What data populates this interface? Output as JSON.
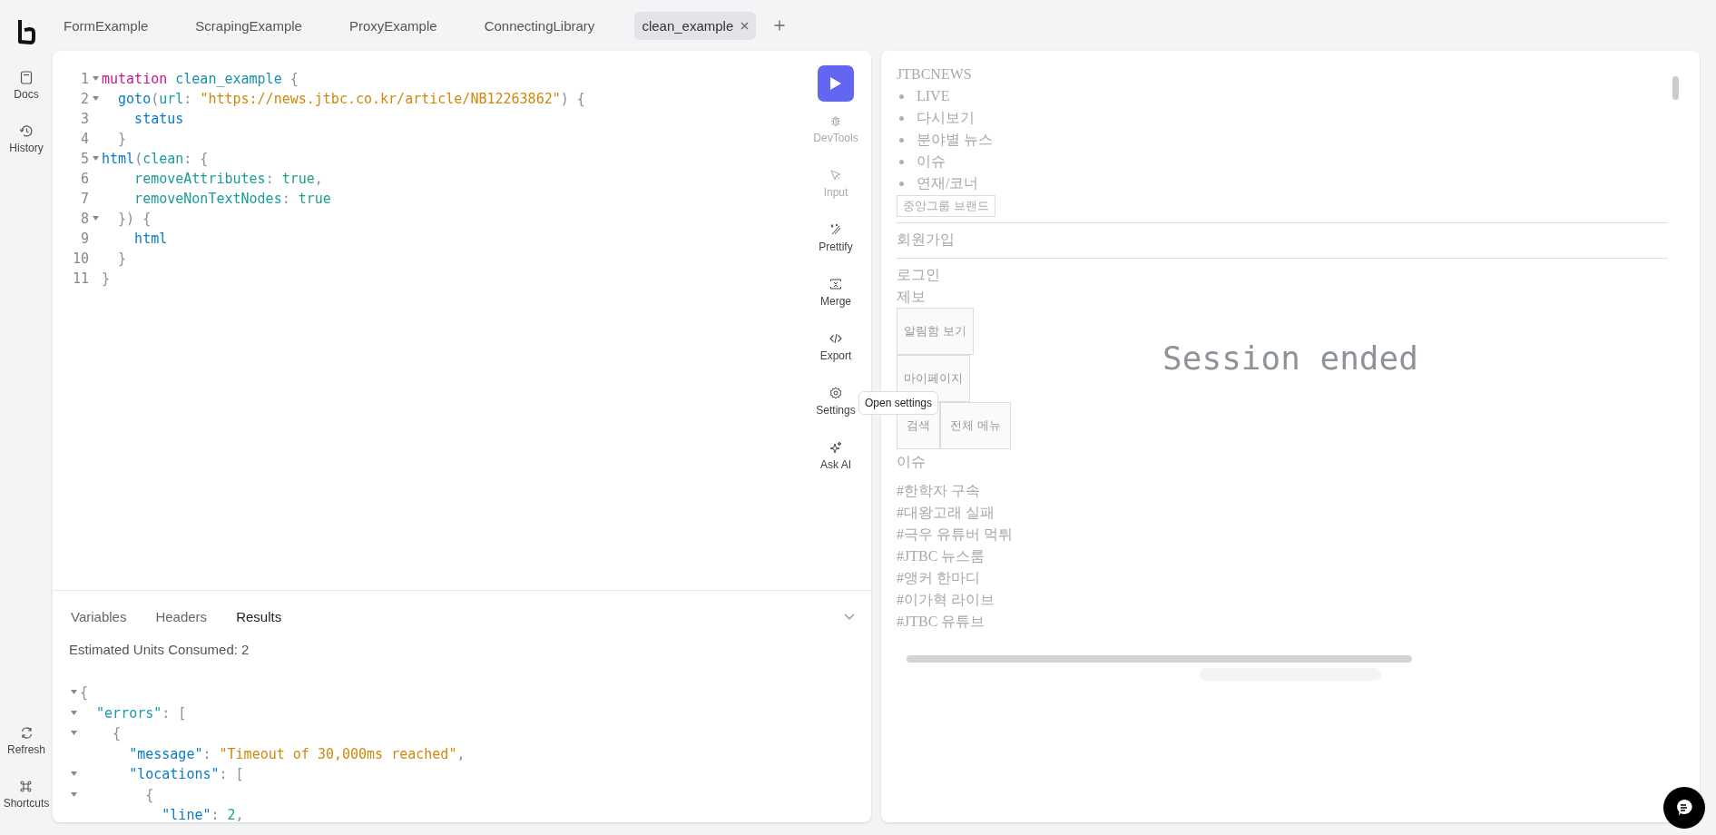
{
  "sidebar": {
    "top": [
      {
        "label": "Docs"
      },
      {
        "label": "History"
      }
    ],
    "bottom": [
      {
        "label": "Refresh"
      },
      {
        "label": "Shortcuts"
      }
    ]
  },
  "tabs": [
    {
      "label": "FormExample",
      "selected": false
    },
    {
      "label": "ScrapingExample",
      "selected": false
    },
    {
      "label": "ProxyExample",
      "selected": false
    },
    {
      "label": "ConnectingLibrary",
      "selected": false
    },
    {
      "label": "clean_example",
      "selected": true
    }
  ],
  "editor": {
    "lines": [
      {
        "number": "1",
        "fold": true,
        "tokens": [
          {
            "t": "mutation",
            "color": "#c8188c"
          },
          {
            "t": " clean_example",
            "color": "#1a8fa8"
          },
          {
            "t": " {",
            "color": "#8a8f98"
          }
        ]
      },
      {
        "number": "2",
        "fold": true,
        "tokens": [
          {
            "t": "  goto",
            "color": "#0b7bc4"
          },
          {
            "t": "(",
            "color": "#8a8f98"
          },
          {
            "t": "url",
            "color": "#1d9b9b"
          },
          {
            "t": ": ",
            "color": "#8a8f98"
          },
          {
            "t": "\"https://news.jtbc.co.kr/article/NB12263862\"",
            "color": "#cf880c"
          },
          {
            "t": ") {",
            "color": "#8a8f98"
          }
        ]
      },
      {
        "number": "3",
        "fold": false,
        "tokens": [
          {
            "t": "    status",
            "color": "#0b7bc4"
          }
        ]
      },
      {
        "number": "4",
        "fold": false,
        "tokens": [
          {
            "t": "  }",
            "color": "#8a8f98"
          }
        ]
      },
      {
        "number": "5",
        "fold": true,
        "tokens": [
          {
            "t": "html",
            "color": "#0b7bc4"
          },
          {
            "t": "(",
            "color": "#8a8f98"
          },
          {
            "t": "clean",
            "color": "#1d9b9b"
          },
          {
            "t": ": {",
            "color": "#8a8f98"
          }
        ]
      },
      {
        "number": "6",
        "fold": false,
        "tokens": [
          {
            "t": "    removeAttributes",
            "color": "#1d9b9b"
          },
          {
            "t": ": ",
            "color": "#8a8f98"
          },
          {
            "t": "true",
            "color": "#1f9e86"
          },
          {
            "t": ",",
            "color": "#8a8f98"
          }
        ]
      },
      {
        "number": "7",
        "fold": false,
        "tokens": [
          {
            "t": "    removeNonTextNodes",
            "color": "#1d9b9b"
          },
          {
            "t": ": ",
            "color": "#8a8f98"
          },
          {
            "t": "true",
            "color": "#1f9e86"
          }
        ]
      },
      {
        "number": "8",
        "fold": true,
        "tokens": [
          {
            "t": "  }) {",
            "color": "#8a8f98"
          }
        ]
      },
      {
        "number": "9",
        "fold": false,
        "tokens": [
          {
            "t": "    html",
            "color": "#0b7bc4"
          }
        ]
      },
      {
        "number": "10",
        "fold": false,
        "tokens": [
          {
            "t": "  }",
            "color": "#8a8f98"
          }
        ]
      },
      {
        "number": "11",
        "fold": false,
        "tokens": [
          {
            "t": "}",
            "color": "#8a8f98"
          }
        ]
      }
    ]
  },
  "toolbar": [
    {
      "label": "DevTools",
      "disabled": true
    },
    {
      "label": "Input",
      "disabled": true
    },
    {
      "label": "Prettify",
      "disabled": false
    },
    {
      "label": "Merge",
      "disabled": false
    },
    {
      "label": "Export",
      "disabled": false
    },
    {
      "label": "Settings",
      "disabled": false
    },
    {
      "label": "Ask AI",
      "disabled": false
    }
  ],
  "tooltip": "Open settings",
  "bottom_panel": {
    "tabs": [
      {
        "label": "Variables",
        "selected": false
      },
      {
        "label": "Headers",
        "selected": false
      },
      {
        "label": "Results",
        "selected": true
      }
    ],
    "units": "Estimated Units Consumed: 2",
    "result_lines": [
      {
        "fold": true,
        "tokens": [
          {
            "t": "{",
            "color": "#8a8f98"
          }
        ]
      },
      {
        "fold": true,
        "tokens": [
          {
            "t": "  \"errors\"",
            "color": "#1a9aa6"
          },
          {
            "t": ": [",
            "color": "#8a8f98"
          }
        ]
      },
      {
        "fold": true,
        "tokens": [
          {
            "t": "    {",
            "color": "#8a8f98"
          }
        ]
      },
      {
        "fold": false,
        "tokens": [
          {
            "t": "      \"message\"",
            "color": "#0b7bc4"
          },
          {
            "t": ": ",
            "color": "#8a8f98"
          },
          {
            "t": "\"Timeout of 30,000ms reached\"",
            "color": "#cf880c"
          },
          {
            "t": ",",
            "color": "#8a8f98"
          }
        ]
      },
      {
        "fold": true,
        "tokens": [
          {
            "t": "      \"locations\"",
            "color": "#0b7bc4"
          },
          {
            "t": ": [",
            "color": "#8a8f98"
          }
        ]
      },
      {
        "fold": true,
        "tokens": [
          {
            "t": "        {",
            "color": "#8a8f98"
          }
        ]
      },
      {
        "fold": false,
        "tokens": [
          {
            "t": "          \"line\"",
            "color": "#0b7bc4"
          },
          {
            "t": ": ",
            "color": "#8a8f98"
          },
          {
            "t": "2",
            "color": "#1f9e86"
          },
          {
            "t": ",",
            "color": "#8a8f98"
          }
        ]
      }
    ]
  },
  "preview": {
    "status": "Session ended",
    "elements": [
      {
        "kind": "title",
        "text": "JTBCNEWS"
      },
      {
        "kind": "bullet",
        "text": "LIVE"
      },
      {
        "kind": "bullet",
        "text": "다시보기"
      },
      {
        "kind": "bullet",
        "text": "분야별 뉴스"
      },
      {
        "kind": "bullet",
        "text": "이슈"
      },
      {
        "kind": "bullet",
        "text": "연재/코너"
      },
      {
        "kind": "small-button",
        "text": "중앙그룹 브랜드"
      },
      {
        "kind": "rule"
      },
      {
        "kind": "text",
        "text": "회원가입"
      },
      {
        "kind": "rule"
      },
      {
        "kind": "line",
        "text": "로그인"
      },
      {
        "kind": "line",
        "text": "제보"
      },
      {
        "kind": "tall-button",
        "text": "알림함 보기"
      },
      {
        "kind": "tall-button",
        "text": "마이페이지"
      },
      {
        "kind": "button-row",
        "buttons": [
          "검색",
          "전체 메뉴"
        ]
      },
      {
        "kind": "text",
        "text": "이슈"
      },
      {
        "kind": "tag",
        "text": "#한학자 구속"
      },
      {
        "kind": "tag",
        "text": "#대왕고래 실패"
      },
      {
        "kind": "tag",
        "text": "#극우 유튜버 먹튀"
      },
      {
        "kind": "tag",
        "text": "#JTBC 뉴스룸"
      },
      {
        "kind": "tag",
        "text": "#앵커 한마디"
      },
      {
        "kind": "tag",
        "text": "#이가혁 라이브"
      },
      {
        "kind": "tag",
        "text": "#JTBC 유튜브"
      }
    ]
  }
}
